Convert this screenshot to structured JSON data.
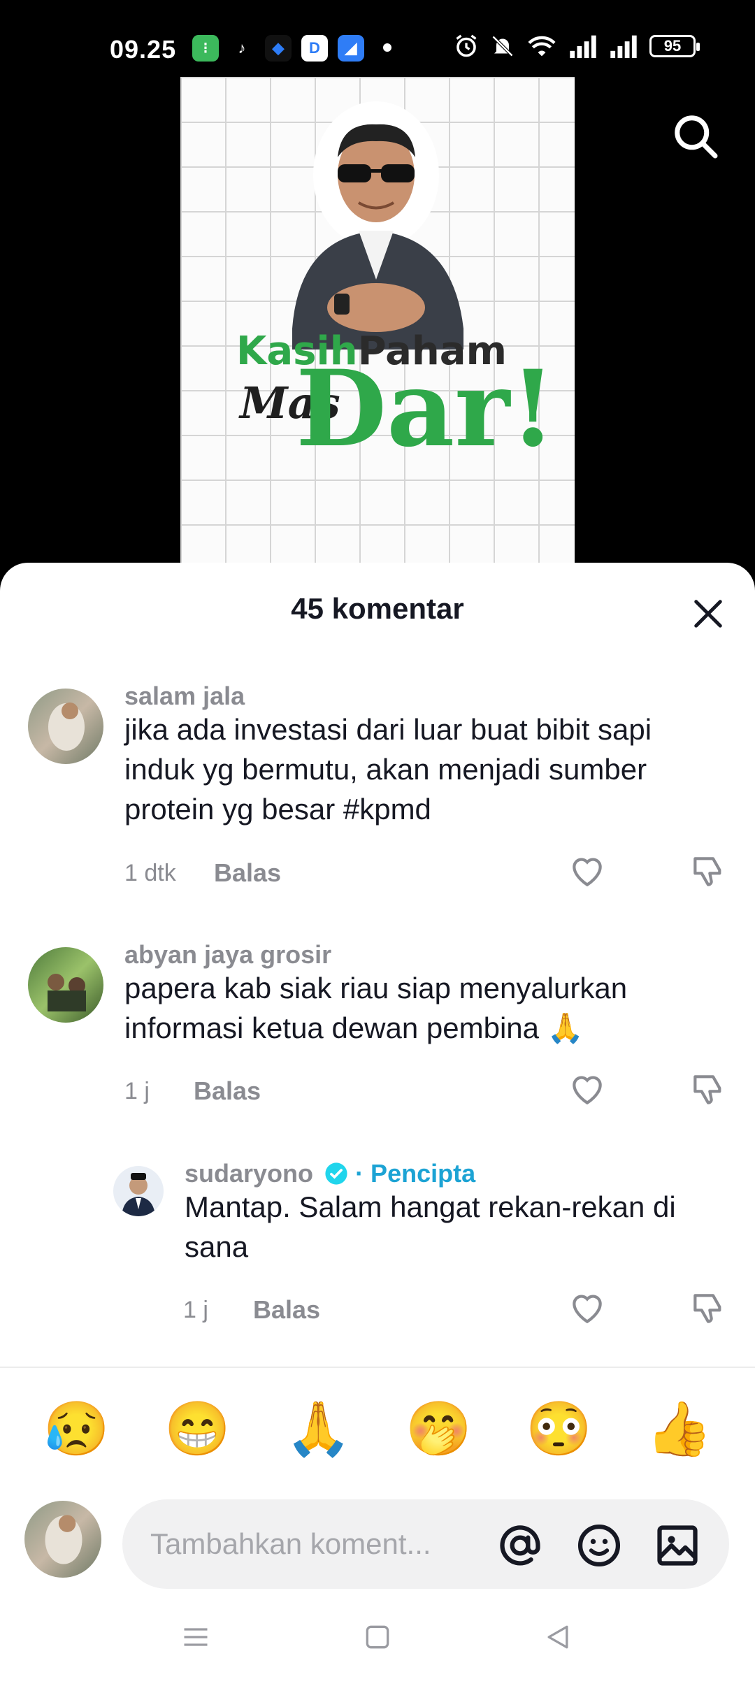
{
  "status_bar": {
    "time": "09.25",
    "battery": "95"
  },
  "video": {
    "title_part1": "Kasih",
    "title_part2": "Paham",
    "title_mas": "Mas",
    "title_dar": "Dar!"
  },
  "sheet": {
    "title": "45 komentar"
  },
  "comments": [
    {
      "user": "salam jala",
      "text": "jika ada investasi dari luar buat bibit sapi induk yg bermutu, akan menjadi sumber protein yg besar #kpmd",
      "time": "1 dtk",
      "reply": "Balas"
    },
    {
      "user": "abyan jaya grosir",
      "text": "papera kab siak riau siap menyalurkan informasi ketua dewan pembina 🙏",
      "time": "1 j",
      "reply": "Balas"
    },
    {
      "user": "sudaryono",
      "creator_label": "· Pencipta",
      "text": "Mantap. Salam hangat rekan-rekan di sana",
      "time": "1 j",
      "reply": "Balas"
    }
  ],
  "emojis": [
    "😥",
    "😁",
    "🙏",
    "🤭",
    "😳",
    "👍"
  ],
  "input": {
    "placeholder": "Tambahkan koment..."
  },
  "colors": {
    "accent_creator": "#1ca3d4",
    "brand_green": "#2fa84a",
    "text_primary": "#161823",
    "text_secondary": "#8a8b91"
  }
}
